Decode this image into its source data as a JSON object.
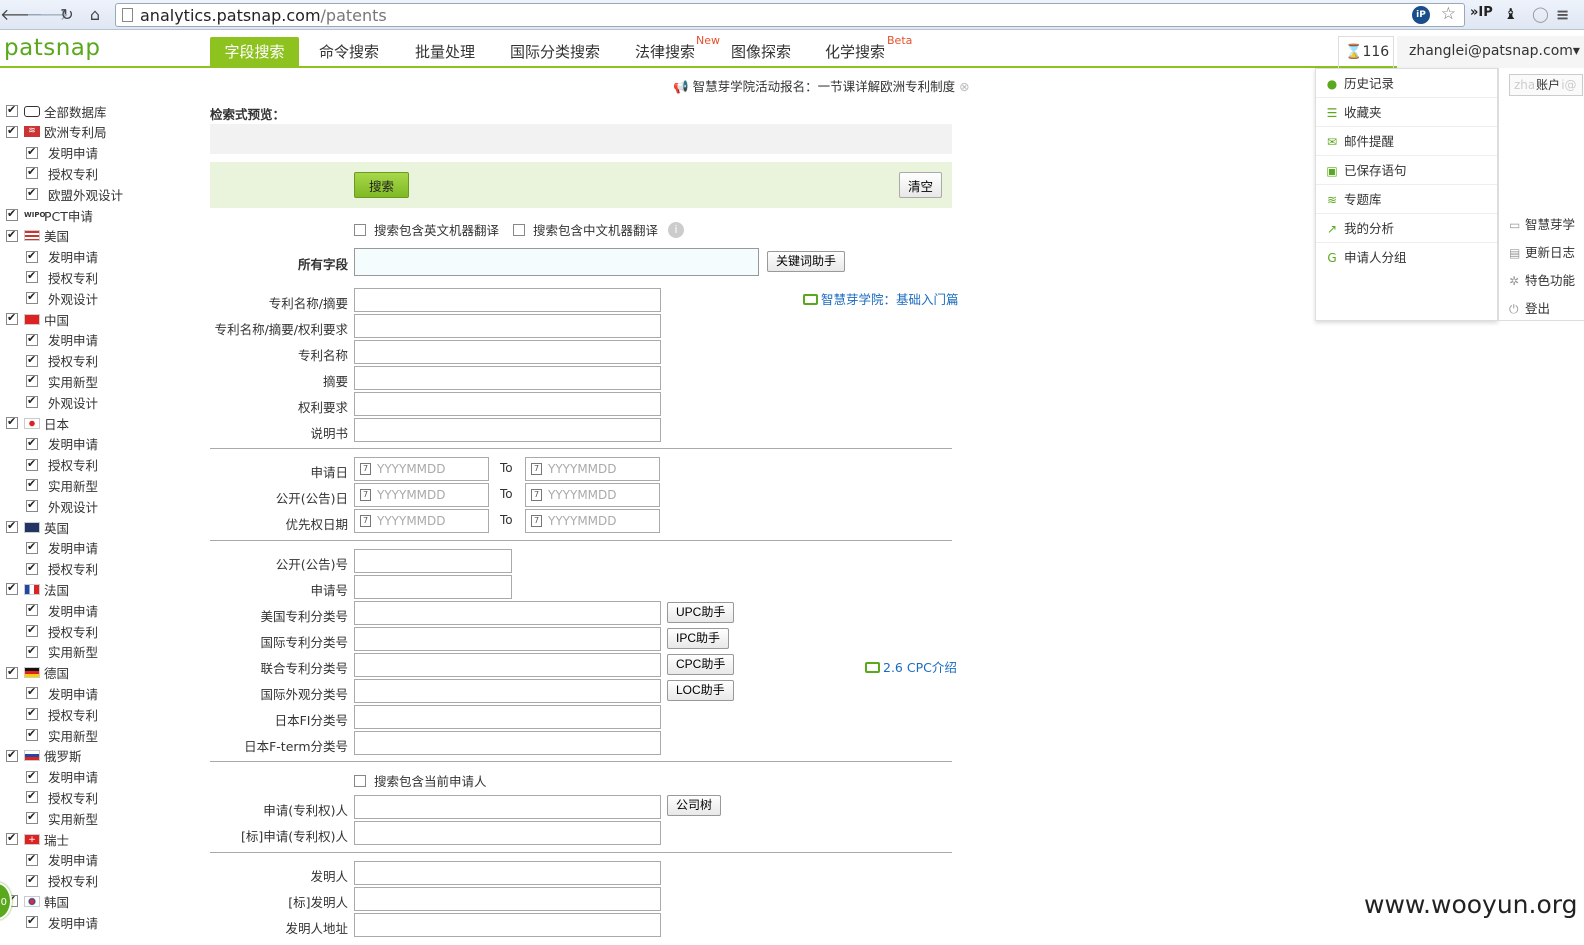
{
  "browser": {
    "url_host": "analytics.patsnap.com",
    "url_path": "/patents",
    "ip_badge": "iP",
    "ext_ip": "»IP"
  },
  "header": {
    "logo": "patsnap",
    "tabs": [
      {
        "label": "字段搜索",
        "active": true
      },
      {
        "label": "命令搜索"
      },
      {
        "label": "批量处理"
      },
      {
        "label": "国际分类搜索"
      },
      {
        "label": "法律搜索",
        "badge": "New"
      },
      {
        "label": "图像探索"
      },
      {
        "label": "化学搜索",
        "badge": "Beta"
      }
    ],
    "timer": "116",
    "user": "zhanglei@patsnap.com▾"
  },
  "dropdown": {
    "items": [
      {
        "label": "历史记录",
        "icon": "clock-icon"
      },
      {
        "label": "收藏夹",
        "icon": "list-icon"
      },
      {
        "label": "邮件提醒",
        "icon": "mail-icon"
      },
      {
        "label": "已保存语句",
        "icon": "save-icon"
      },
      {
        "label": "专题库",
        "icon": "database-icon"
      },
      {
        "label": "我的分析",
        "icon": "chart-icon"
      },
      {
        "label": "申请人分组",
        "icon": "group-icon"
      }
    ]
  },
  "right_panel": {
    "account_placeholder": "zhanglei@",
    "account_label": "账户",
    "items": [
      "智慧芽学",
      "更新日志",
      "特色功能",
      "登出"
    ]
  },
  "announcement": "智慧芽学院活动报名：一节课详解欧洲专利制度",
  "sidebar": {
    "items": [
      {
        "label": "全部数据库",
        "level": 0,
        "icon": "database"
      },
      {
        "label": "欧洲专利局",
        "level": 0,
        "icon": "epo"
      },
      {
        "label": "发明申请",
        "level": 1
      },
      {
        "label": "授权专利",
        "level": 1
      },
      {
        "label": "欧盟外观设计",
        "level": 1
      },
      {
        "label": "PCT申请",
        "level": 0,
        "icon": "wipo"
      },
      {
        "label": "美国",
        "level": 0,
        "icon": "flag-us"
      },
      {
        "label": "发明申请",
        "level": 1
      },
      {
        "label": "授权专利",
        "level": 1
      },
      {
        "label": "外观设计",
        "level": 1
      },
      {
        "label": "中国",
        "level": 0,
        "icon": "flag-cn"
      },
      {
        "label": "发明申请",
        "level": 1
      },
      {
        "label": "授权专利",
        "level": 1
      },
      {
        "label": "实用新型",
        "level": 1
      },
      {
        "label": "外观设计",
        "level": 1
      },
      {
        "label": "日本",
        "level": 0,
        "icon": "flag-jp"
      },
      {
        "label": "发明申请",
        "level": 1
      },
      {
        "label": "授权专利",
        "level": 1
      },
      {
        "label": "实用新型",
        "level": 1
      },
      {
        "label": "外观设计",
        "level": 1
      },
      {
        "label": "英国",
        "level": 0,
        "icon": "flag-gb"
      },
      {
        "label": "发明申请",
        "level": 1
      },
      {
        "label": "授权专利",
        "level": 1
      },
      {
        "label": "法国",
        "level": 0,
        "icon": "flag-fr"
      },
      {
        "label": "发明申请",
        "level": 1
      },
      {
        "label": "授权专利",
        "level": 1
      },
      {
        "label": "实用新型",
        "level": 1
      },
      {
        "label": "德国",
        "level": 0,
        "icon": "flag-de"
      },
      {
        "label": "发明申请",
        "level": 1
      },
      {
        "label": "授权专利",
        "level": 1
      },
      {
        "label": "实用新型",
        "level": 1
      },
      {
        "label": "俄罗斯",
        "level": 0,
        "icon": "flag-ru"
      },
      {
        "label": "发明申请",
        "level": 1
      },
      {
        "label": "授权专利",
        "level": 1
      },
      {
        "label": "实用新型",
        "level": 1
      },
      {
        "label": "瑞士",
        "level": 0,
        "icon": "flag-ch"
      },
      {
        "label": "发明申请",
        "level": 1
      },
      {
        "label": "授权专利",
        "level": 1
      },
      {
        "label": "韩国",
        "level": 0,
        "icon": "flag-kr"
      },
      {
        "label": "发明申请",
        "level": 1
      }
    ]
  },
  "main": {
    "preview_label": "检索式预览：",
    "search_label": "搜索",
    "clear_label": "清空",
    "opt_en_translate": "搜索包含英文机器翻译",
    "opt_cn_translate": "搜索包含中文机器翻译",
    "all_fields_label": "所有字段",
    "keyword_helper": "关键词助手",
    "academy_link": "智慧芽学院：基础入门篇",
    "text_fields": [
      "专利名称/摘要",
      "专利名称/摘要/权利要求",
      "专利名称",
      "摘要",
      "权利要求",
      "说明书"
    ],
    "date_fields": [
      "申请日",
      "公开(公告)日",
      "优先权日期"
    ],
    "date_placeholder": "YYYYMMDD",
    "to_label": "To",
    "number_fields": [
      "公开(公告)号",
      "申请号"
    ],
    "class_fields": [
      "美国专利分类号",
      "国际专利分类号",
      "联合专利分类号",
      "国际外观分类号",
      "日本FI分类号",
      "日本F-term分类号"
    ],
    "class_helpers": [
      "UPC助手",
      "IPC助手",
      "CPC助手",
      "LOC助手"
    ],
    "cpc_link": "2.6 CPC介绍",
    "opt_current_applicant": "搜索包含当前申请人",
    "applicant_fields": [
      "申请(专利权)人",
      "[标]申请(专利权)人"
    ],
    "company_tree": "公司树",
    "inventor_fields": [
      "发明人",
      "[标]发明人",
      "发明人地址"
    ]
  },
  "watermark": "www.wooyun.org",
  "green_badge": "0",
  "colors": {
    "brand": "#8dc21f",
    "link": "#1a6bc0"
  }
}
